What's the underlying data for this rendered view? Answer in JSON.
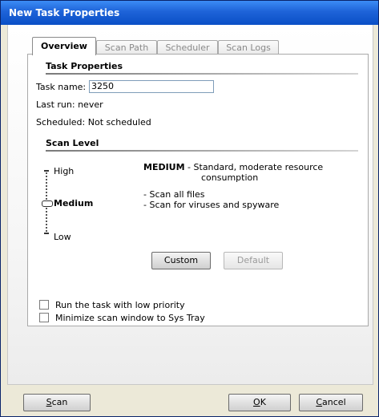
{
  "window": {
    "title": "New Task Properties"
  },
  "tabs": [
    {
      "label": "Overview"
    },
    {
      "label": "Scan Path"
    },
    {
      "label": "Scheduler"
    },
    {
      "label": "Scan Logs"
    }
  ],
  "task_properties": {
    "heading": "Task Properties",
    "name_label": "Task name:",
    "name_value": "3250",
    "last_run": "Last run: never",
    "scheduled": "Scheduled: Not scheduled"
  },
  "scan_level": {
    "heading": "Scan Level",
    "levels": {
      "high": "High",
      "medium": "Medium",
      "low": "Low"
    },
    "selected": "Medium",
    "desc_strong": "MEDIUM",
    "desc_line1": " - Standard, moderate resource",
    "desc_line2": "consumption",
    "bullet1": "- Scan all files",
    "bullet2": "- Scan for viruses and spyware",
    "custom_button": "Custom",
    "default_button": "Default"
  },
  "options": {
    "low_priority": {
      "label": "Run the task with low priority",
      "checked": false
    },
    "minimize": {
      "label": "Minimize scan window to Sys Tray",
      "checked": false
    }
  },
  "footer": {
    "scan_prefix": "S",
    "scan_rest": "can",
    "ok_prefix": "O",
    "ok_rest": "K",
    "cancel_prefix": "C",
    "cancel_rest": "ancel"
  }
}
